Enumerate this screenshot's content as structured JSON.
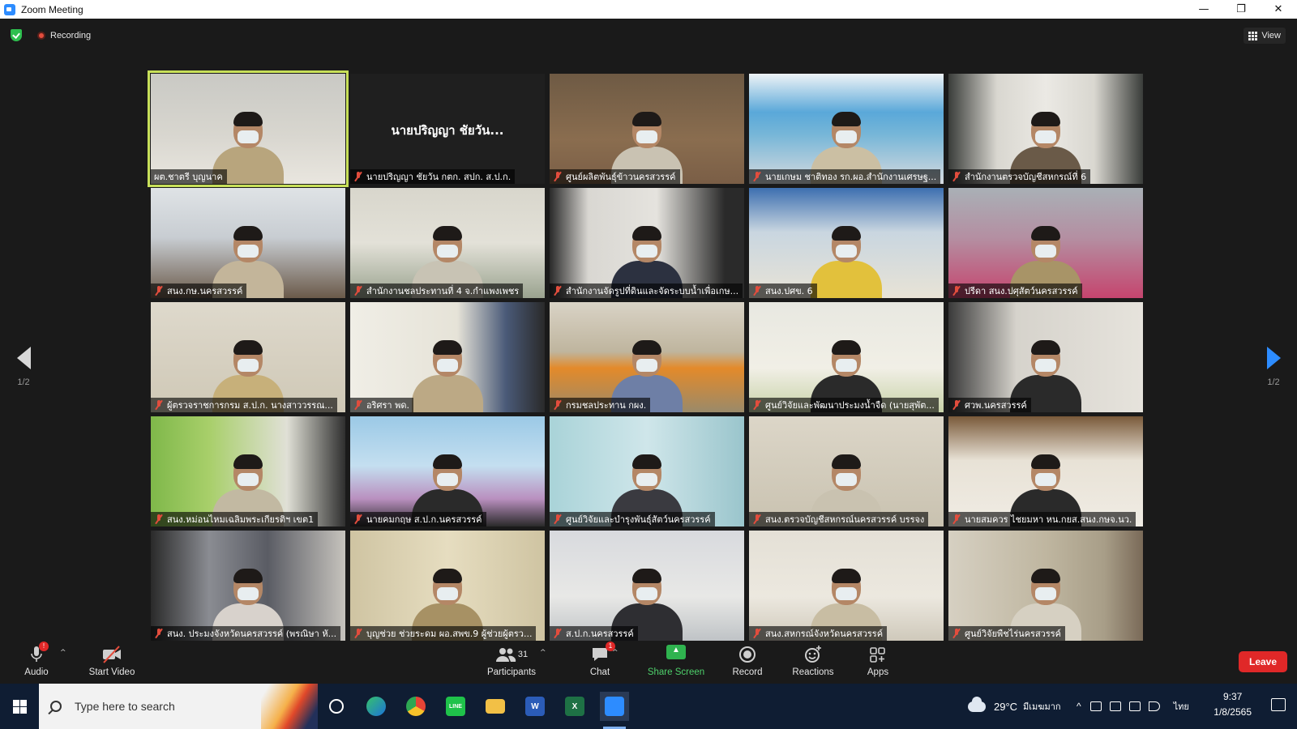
{
  "window": {
    "title": "Zoom Meeting",
    "controls": {
      "minimize": "—",
      "restore": "❐",
      "close": "✕"
    }
  },
  "meeting": {
    "recording_label": "Recording",
    "view_label": "View",
    "page_indicator": "1/2"
  },
  "participants": [
    {
      "name": "ผต.ชาตรี บุญนาค",
      "video": true,
      "active": true,
      "muted": false,
      "scene": "office-windows"
    },
    {
      "name": "นายปริญญา ชัยวัน กตก. สปก. ส.ป.ก.",
      "video": false,
      "display_name": "นายปริญญา ชัยวัน...",
      "muted": true
    },
    {
      "name": "ศูนย์ผลิตพันธุ์ข้าวนครสวรรค์",
      "video": true,
      "muted": true,
      "scene": "flowers"
    },
    {
      "name": "นายเกษม ชาติทอง รก.ผอ.สำนักงานเศรษฐ...",
      "video": true,
      "muted": true,
      "scene": "banner-blue"
    },
    {
      "name": "สำนักงานตรวจบัญชีสหกรณ์ที่ 6",
      "video": true,
      "muted": true,
      "scene": "emblem"
    },
    {
      "name": "สนง.กษ.นครสวรรค์",
      "video": true,
      "muted": true,
      "scene": "meeting-room"
    },
    {
      "name": "สำนักงานชลประทานที่ 4 จ.กำแพงเพชร",
      "video": true,
      "muted": true,
      "scene": "conference"
    },
    {
      "name": "สำนักงานจัดรูปที่ดินและจัดระบบน้ำเพื่อเกษ...",
      "video": true,
      "muted": true,
      "scene": "dark-office"
    },
    {
      "name": "สนง.ปศข. 6",
      "video": true,
      "muted": true,
      "scene": "yellow-shirt"
    },
    {
      "name": "ปรีดา สนง.ปศุสัตว์นครสวรรค์",
      "video": true,
      "muted": true,
      "scene": "pink-field"
    },
    {
      "name": "ผู้ตรวจราชการกรม ส.ป.ก. นางสาววรรณ...",
      "video": true,
      "muted": true,
      "scene": "cream-wall"
    },
    {
      "name": "อริศรา พด.",
      "video": true,
      "muted": true,
      "scene": "window-office"
    },
    {
      "name": "กรมชลประทาน กผง.",
      "video": true,
      "muted": true,
      "scene": "orange-chairs"
    },
    {
      "name": "ศูนย์วิจัยและพัฒนาประมงน้ำจืด (นายสุพัต...",
      "video": true,
      "muted": true,
      "scene": "shrine"
    },
    {
      "name": "ศวพ.นครสวรรค์",
      "video": true,
      "muted": true,
      "scene": "calendar"
    },
    {
      "name": "สนง.หม่อนไหมเฉลิมพระเกียรติฯ เขต1",
      "video": true,
      "muted": true,
      "scene": "green-curtain"
    },
    {
      "name": "นายคมกฤษ ส.ป.ก.นครสวรรค์",
      "video": true,
      "muted": true,
      "scene": "poster"
    },
    {
      "name": "ศูนย์วิจัยและบำรุงพันธุ์สัตว์นครสวรรค์",
      "video": true,
      "muted": true,
      "scene": "teal-curtain"
    },
    {
      "name": "สนง.ตรวจบัญชีสหกรณ์นครสวรรค์ บรรจง",
      "video": true,
      "muted": true,
      "scene": "beige-office"
    },
    {
      "name": "นายสมควร ไชยมหา หน.กยส.สนง.กษจ.นว.",
      "video": true,
      "muted": true,
      "scene": "horse-painting"
    },
    {
      "name": "สนง. ประมงจังหวัดนครสวรรค์ (พรณิษา หั...",
      "video": true,
      "muted": true,
      "scene": "shelves"
    },
    {
      "name": "บุญช่วย ช่วยระดม ผอ.สพข.9 ผู้ช่วยผู้ตรว...",
      "video": true,
      "muted": true,
      "scene": "cream-curtain"
    },
    {
      "name": "ส.ป.ก.นครสวรรค์",
      "video": true,
      "muted": true,
      "scene": "white-wall"
    },
    {
      "name": "สนง.สหกรณ์จังหวัดนครสวรรค์",
      "video": true,
      "muted": true,
      "scene": "frame-wall"
    },
    {
      "name": "ศูนย์วิจัยพืชไร่นครสวรรค์",
      "video": true,
      "muted": true,
      "scene": "bookshelf"
    }
  ],
  "toolbar": {
    "audio_label": "Audio",
    "audio_badge": "!",
    "video_label": "Start Video",
    "participants_label": "Participants",
    "participants_count": "31",
    "chat_label": "Chat",
    "chat_badge": "1",
    "share_label": "Share Screen",
    "record_label": "Record",
    "reactions_label": "Reactions",
    "apps_label": "Apps",
    "leave_label": "Leave",
    "caret": "^"
  },
  "taskbar": {
    "search_placeholder": "Type here to search",
    "weather": "29°C",
    "weather_desc": "มีเมฆมาก",
    "language": "ไทย",
    "time": "9:37",
    "date": "1/8/2565",
    "word_label": "W",
    "excel_label": "X",
    "line_label": "LINE"
  },
  "colors": {
    "active_speaker": "#c8e05a",
    "leave": "#e02828",
    "share": "#2fb34f",
    "accent": "#2d8cff",
    "muted_icon": "#e24d3d"
  }
}
